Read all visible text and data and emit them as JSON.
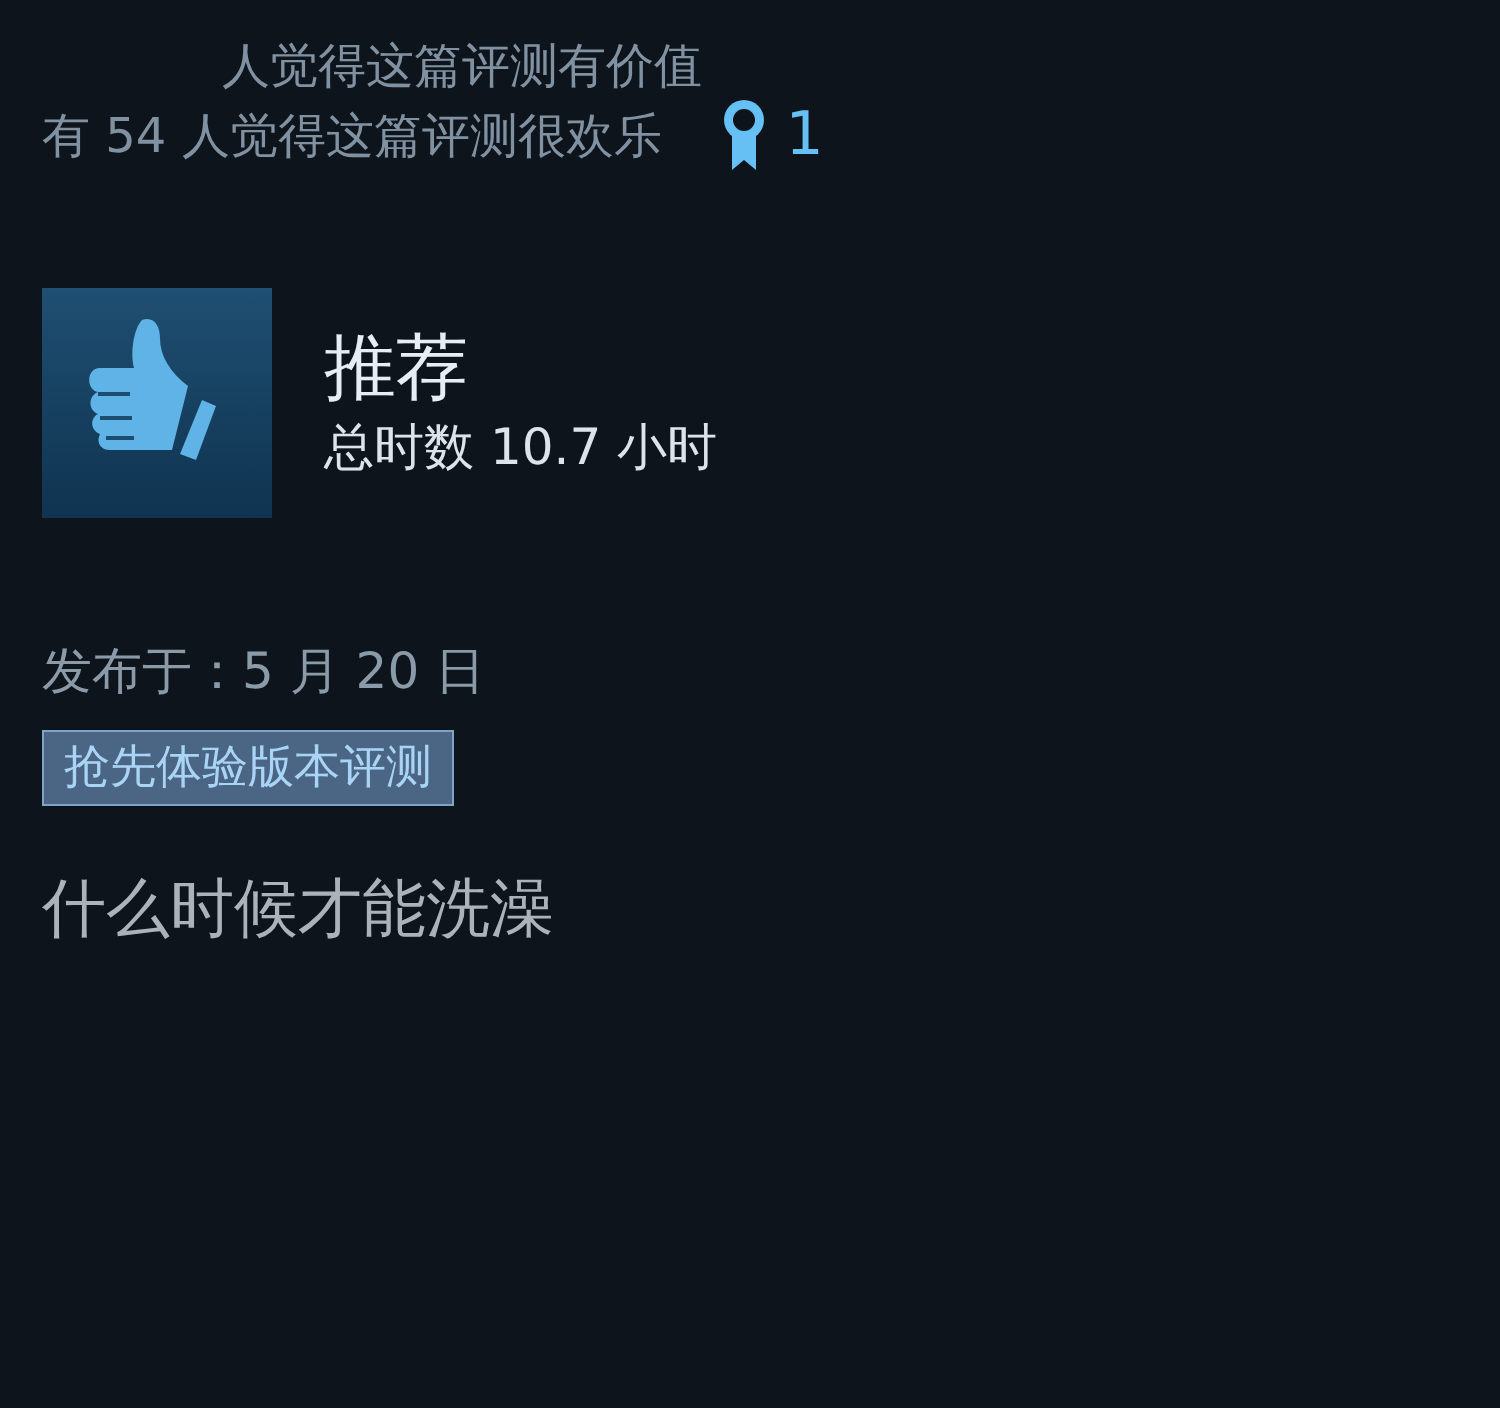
{
  "votes": {
    "helpful": "人觉得这篇评测有价值",
    "funny": "有 54 人觉得这篇评测很欢乐",
    "awards": "1"
  },
  "review": {
    "recommended": true,
    "verdict": "推荐",
    "playtime": "总时数 10.7 小时",
    "posted": "发布于：5 月 20 日",
    "tag": "抢先体验版本评测",
    "text": "什么时候才能洗澡"
  }
}
